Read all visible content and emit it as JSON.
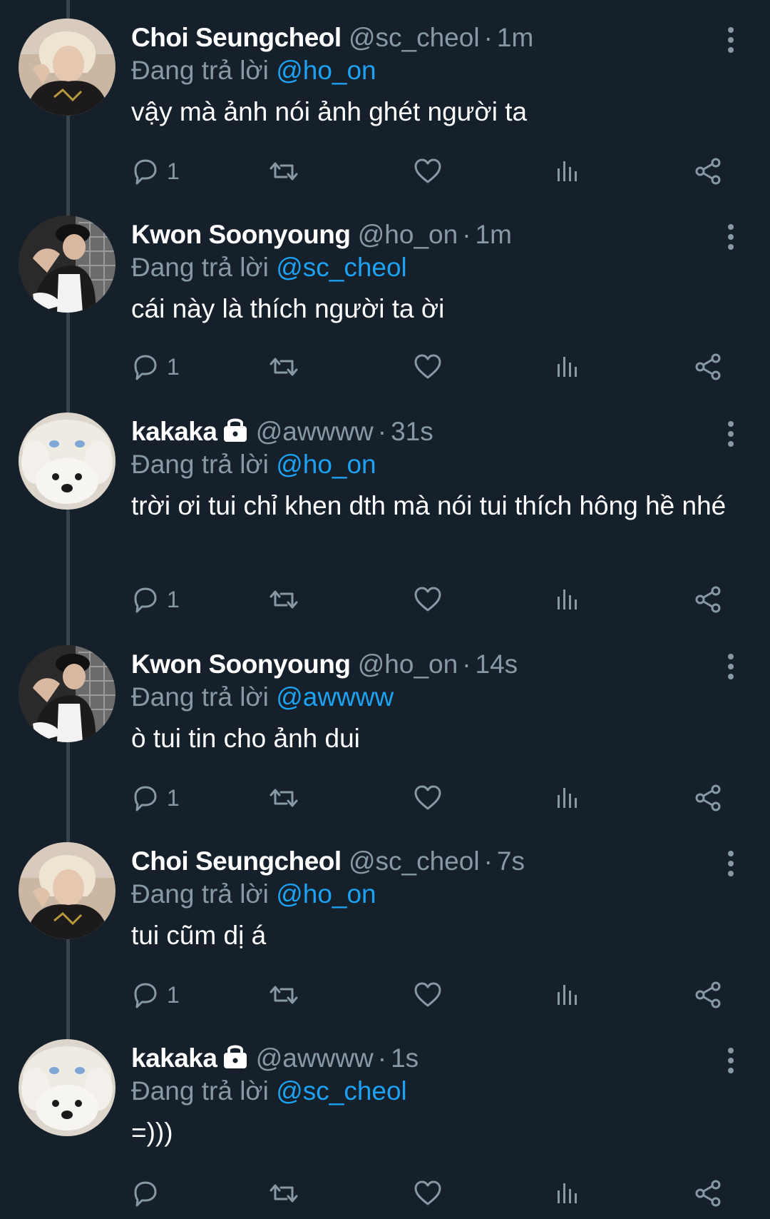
{
  "reply_prefix": "Đang trả lời",
  "colors": {
    "background": "#15202b",
    "name": "#ffffff",
    "muted": "#8899a6",
    "mention": "#1da1f2",
    "thread_line": "#38444d"
  },
  "icons": {
    "reply": "reply-icon",
    "retweet": "retweet-icon",
    "like": "heart-icon",
    "analytics": "analytics-icon",
    "share": "share-icon",
    "more": "more-icon",
    "lock": "lock-icon"
  },
  "tweets": [
    {
      "name": "Choi Seungcheol",
      "handle": "@sc_cheol",
      "dot": "·",
      "time": "1m",
      "reply_to": "@ho_on",
      "text": "vậy mà ảnh nói ảnh ghét người ta",
      "reply_count": "1"
    },
    {
      "name": "Kwon Soonyoung",
      "handle": "@ho_on",
      "dot": "·",
      "time": "1m",
      "reply_to": "@sc_cheol",
      "text": "cái này là thích người ta ời",
      "reply_count": "1"
    },
    {
      "name": "kakaka",
      "handle": "@awwww",
      "dot": "·",
      "time": "31s",
      "reply_to": "@ho_on",
      "text": "trời ơi tui chỉ khen dth mà nói tui thích hông hề nhé",
      "reply_count": "1"
    },
    {
      "name": "Kwon Soonyoung",
      "handle": "@ho_on",
      "dot": "·",
      "time": "14s",
      "reply_to": "@awwww",
      "text": "ò tui tin cho ảnh dui",
      "reply_count": "1"
    },
    {
      "name": "Choi Seungcheol",
      "handle": "@sc_cheol",
      "dot": "·",
      "time": "7s",
      "reply_to": "@ho_on",
      "text": "tui cũm dị á",
      "reply_count": "1"
    },
    {
      "name": "kakaka",
      "handle": "@awwww",
      "dot": "·",
      "time": "1s",
      "reply_to": "@sc_cheol",
      "text": "=)))",
      "reply_count": ""
    }
  ]
}
